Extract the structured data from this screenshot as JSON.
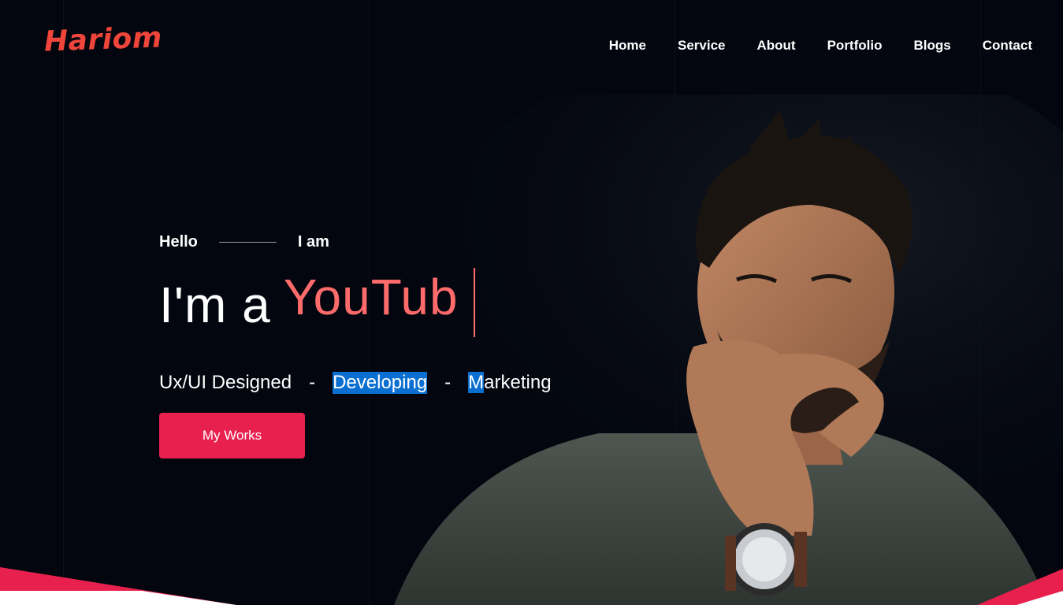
{
  "brand": {
    "logo_text": "Hariom",
    "accent": "#f0453a"
  },
  "nav": {
    "items": [
      {
        "label": "Home"
      },
      {
        "label": "Service"
      },
      {
        "label": "About"
      },
      {
        "label": "Portfolio"
      },
      {
        "label": "Blogs"
      },
      {
        "label": "Contact"
      }
    ]
  },
  "hero": {
    "hello": "Hello",
    "i_am": "I am",
    "headline_prefix": "I'm a",
    "typed_text": "YouTub",
    "typed_color": "#ff6b6b",
    "skills": {
      "first": "Ux/UI Designed",
      "separator": "-",
      "second": "Developing",
      "third_first_letter": "M",
      "third_rest": "arketing"
    },
    "cta_label": "My Works",
    "cta_color": "#e8204e",
    "selection_color": "#0a6fd1",
    "background": "#03060f"
  },
  "portrait": {
    "icon": "person-portrait-image"
  }
}
